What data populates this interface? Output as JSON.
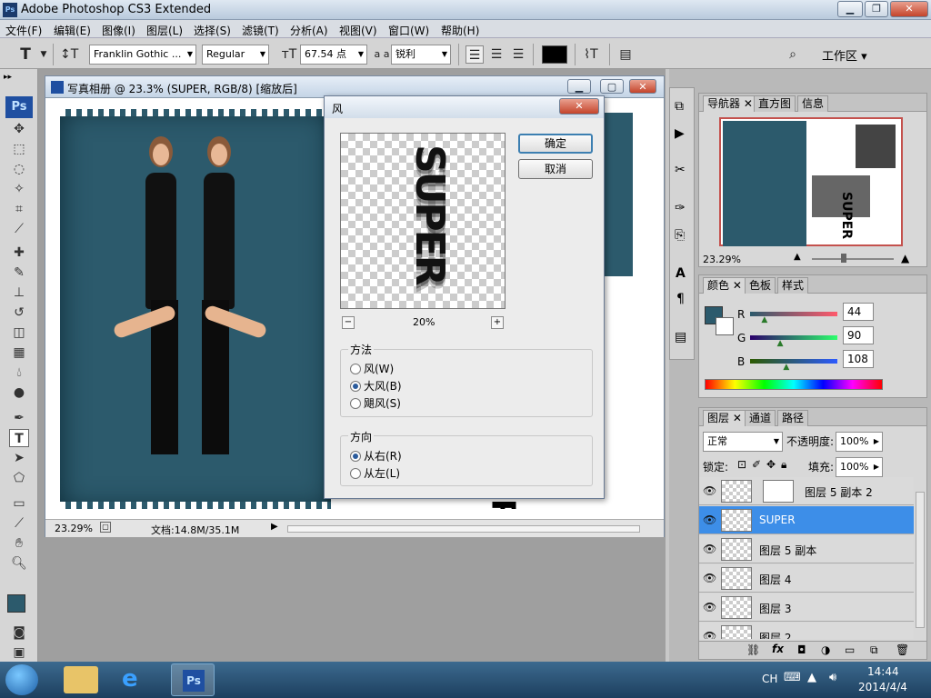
{
  "app": {
    "title": "Adobe Photoshop CS3 Extended",
    "logo": "Ps"
  },
  "menu": [
    "文件(F)",
    "编辑(E)",
    "图像(I)",
    "图层(L)",
    "选择(S)",
    "滤镜(T)",
    "分析(A)",
    "视图(V)",
    "窗口(W)",
    "帮助(H)"
  ],
  "options": {
    "tool_glyph": "T",
    "font_family": "Franklin Gothic ...",
    "font_style": "Regular",
    "font_size": "67.54 点",
    "aa_label": "a a",
    "antialias": "锐利",
    "workspace_label": "工作区 ▾",
    "color": "#000000"
  },
  "document": {
    "title": "写真相册 @ 23.3% (SUPER, RGB/8) [缩放后]",
    "zoom": "23.29%",
    "doc_info": "文档:14.8M/35.1M",
    "canvas_text": "SUPER"
  },
  "dialog": {
    "title": "风",
    "ok_label": "确定",
    "cancel_label": "取消",
    "preview_zoom": "20%",
    "zoom_out": "−",
    "zoom_in": "+",
    "preview_text": "SUPER",
    "method_title": "方法",
    "methods": [
      {
        "label": "风(W)",
        "selected": false
      },
      {
        "label": "大风(B)",
        "selected": true
      },
      {
        "label": "飓风(S)",
        "selected": false
      }
    ],
    "direction_title": "方向",
    "directions": [
      {
        "label": "从右(R)",
        "selected": true
      },
      {
        "label": "从左(L)",
        "selected": false
      }
    ]
  },
  "navigator": {
    "tabs": [
      "导航器",
      "直方图",
      "信息"
    ],
    "zoom": "23.29%",
    "thumb_text": "SUPER"
  },
  "color_panel": {
    "tabs": [
      "颜色",
      "色板",
      "样式"
    ],
    "r_label": "R",
    "g_label": "G",
    "b_label": "B",
    "r": "44",
    "g": "90",
    "b": "108",
    "swatch": "#2c5a6c",
    "r_level": 0.17,
    "g_level": 0.35,
    "b_level": 0.42
  },
  "layers_panel": {
    "tabs": [
      "图层",
      "通道",
      "路径"
    ],
    "blend_mode": "正常",
    "opacity_label": "不透明度:",
    "opacity": "100%",
    "lock_label": "锁定:",
    "fill_label": "填充:",
    "fill": "100%",
    "layers": [
      {
        "name": "图层 5 副本 2",
        "selected": false
      },
      {
        "name": "SUPER",
        "selected": true
      },
      {
        "name": "图层 5 副本",
        "selected": false
      },
      {
        "name": "图层 4",
        "selected": false
      },
      {
        "name": "图层 3",
        "selected": false
      },
      {
        "name": "图层 2",
        "selected": false
      }
    ]
  },
  "taskbar": {
    "lang": "CH",
    "time": "14:44",
    "date": "2014/4/4"
  },
  "colors": {
    "teal": "#2c5a6c",
    "selection": "#3d8ee8"
  }
}
